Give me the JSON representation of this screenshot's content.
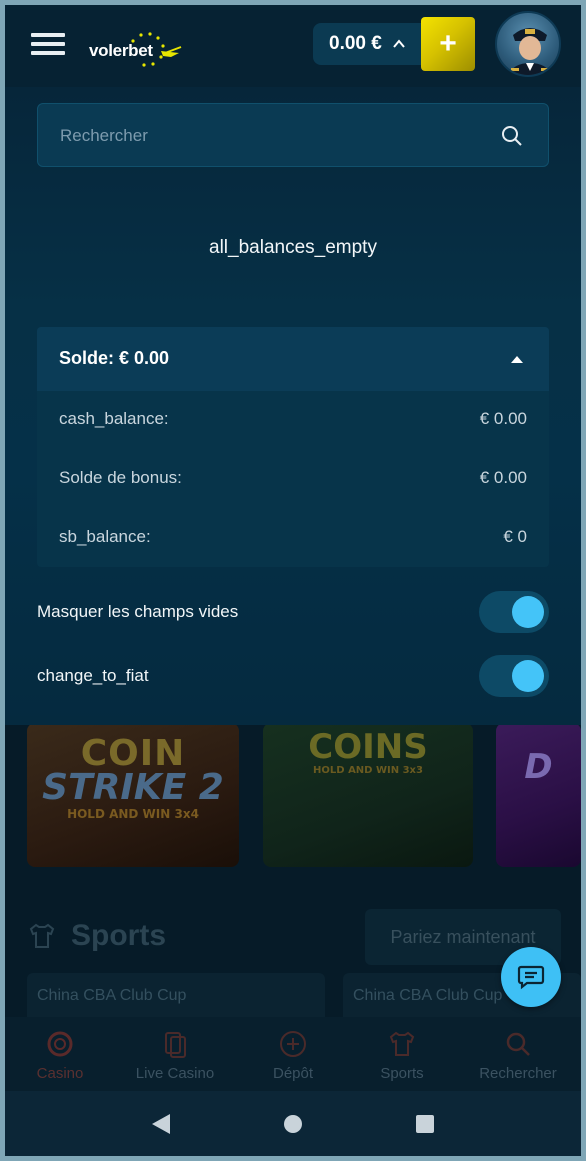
{
  "header": {
    "logo_text": "volerbet",
    "balance": "0.00 €",
    "deposit_symbol": "+"
  },
  "panel": {
    "search_placeholder": "Rechercher",
    "all_balances_label": "all_balances_empty",
    "solde": {
      "title": "Solde: € 0.00",
      "rows": [
        {
          "label": "cash_balance:",
          "value": "€ 0.00"
        },
        {
          "label": "Solde de bonus:",
          "value": "€ 0.00"
        },
        {
          "label": "sb_balance:",
          "value": "€ 0"
        }
      ]
    },
    "toggles": [
      {
        "label": "Masquer les champs vides",
        "on": true
      },
      {
        "label": "change_to_fiat",
        "on": true
      }
    ]
  },
  "background": {
    "games": [
      {
        "line1": "COIN",
        "line2": "STRIKE 2",
        "line3": "HOLD AND WIN 3x4"
      },
      {
        "line1": "COINS",
        "line3": "HOLD AND WIN 3x3"
      },
      {
        "line1": "D"
      }
    ],
    "sports_title": "Sports",
    "bet_button": "Pariez maintenant",
    "match_cards": [
      "China CBA Club Cup",
      "China CBA Club Cup"
    ],
    "nav": [
      {
        "label": "Casino",
        "icon": "casino-chip-icon"
      },
      {
        "label": "Live Casino",
        "icon": "live-casino-icon"
      },
      {
        "label": "Dépôt",
        "icon": "deposit-plus-icon"
      },
      {
        "label": "Sports",
        "icon": "jersey-icon"
      },
      {
        "label": "Rechercher",
        "icon": "search-icon"
      }
    ]
  },
  "colors": {
    "accent": "#44c4f8",
    "deposit_yellow": "#f4e300",
    "panel_bg": "#063046"
  }
}
